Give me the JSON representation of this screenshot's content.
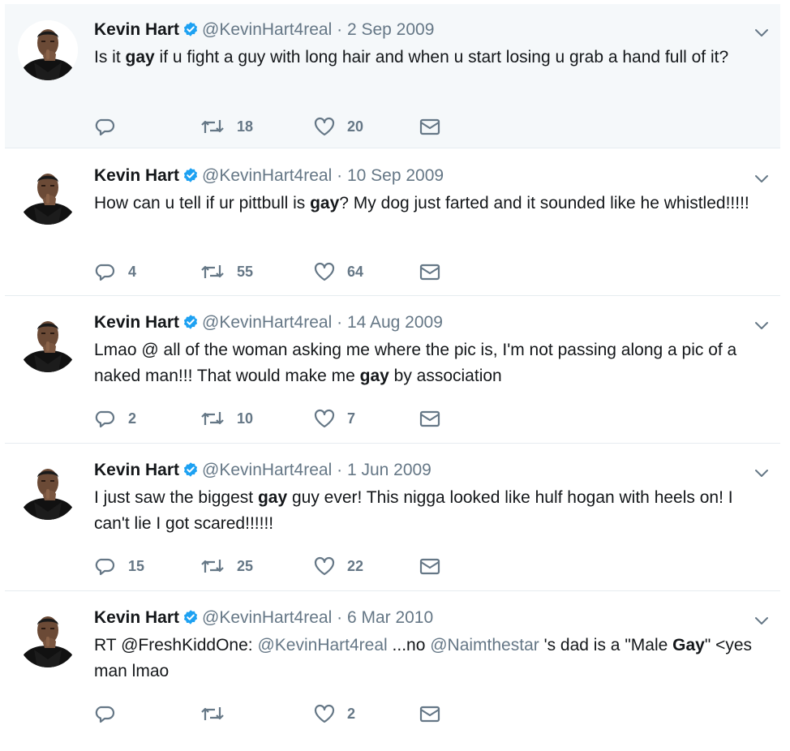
{
  "author": {
    "name": "Kevin Hart",
    "handle": "@KevinHart4real",
    "separator": "·"
  },
  "icons": {
    "verified": "verified-badge-icon",
    "reply": "reply-icon",
    "retweet": "retweet-icon",
    "like": "heart-icon",
    "dm": "envelope-icon",
    "menu": "chevron-down-icon"
  },
  "colors": {
    "verified": "#1da1f2",
    "muted": "#657786",
    "highlight_bg": "#f5f8fa"
  },
  "tweets": [
    {
      "date": "2 Sep 2009",
      "text": [
        {
          "t": "Is it "
        },
        {
          "t": "gay",
          "b": true
        },
        {
          "t": " if u fight a guy with long hair and when u start losing u grab a hand full of it?"
        }
      ],
      "replies": "",
      "retweets": "18",
      "likes": "20"
    },
    {
      "date": "10 Sep 2009",
      "text": [
        {
          "t": "How can u tell if ur pittbull is "
        },
        {
          "t": "gay",
          "b": true
        },
        {
          "t": "? My dog just farted and it sounded like he whistled!!!!!"
        }
      ],
      "replies": "4",
      "retweets": "55",
      "likes": "64"
    },
    {
      "date": "14 Aug 2009",
      "text": [
        {
          "t": "Lmao @ all of the woman asking me where the pic is, I'm not passing along a pic of a naked man!!! That would make me "
        },
        {
          "t": "gay",
          "b": true
        },
        {
          "t": " by association"
        }
      ],
      "replies": "2",
      "retweets": "10",
      "likes": "7"
    },
    {
      "date": "1 Jun 2009",
      "text": [
        {
          "t": "I just saw the biggest "
        },
        {
          "t": "gay",
          "b": true
        },
        {
          "t": " guy ever! This nigga looked like hulf hogan with heels on! I can't lie I got scared!!!!!!"
        }
      ],
      "replies": "15",
      "retweets": "25",
      "likes": "22"
    },
    {
      "date": "6 Mar 2010",
      "text": [
        {
          "t": "RT @FreshKiddOne: "
        },
        {
          "t": "@KevinHart4real",
          "m": true
        },
        {
          "t": " ...no "
        },
        {
          "t": "@Naimthestar",
          "m": true
        },
        {
          "t": " 's dad is a \"Male "
        },
        {
          "t": "Gay",
          "b": true
        },
        {
          "t": "\" <yes man lmao"
        }
      ],
      "replies": "",
      "retweets": "",
      "likes": "2"
    }
  ]
}
